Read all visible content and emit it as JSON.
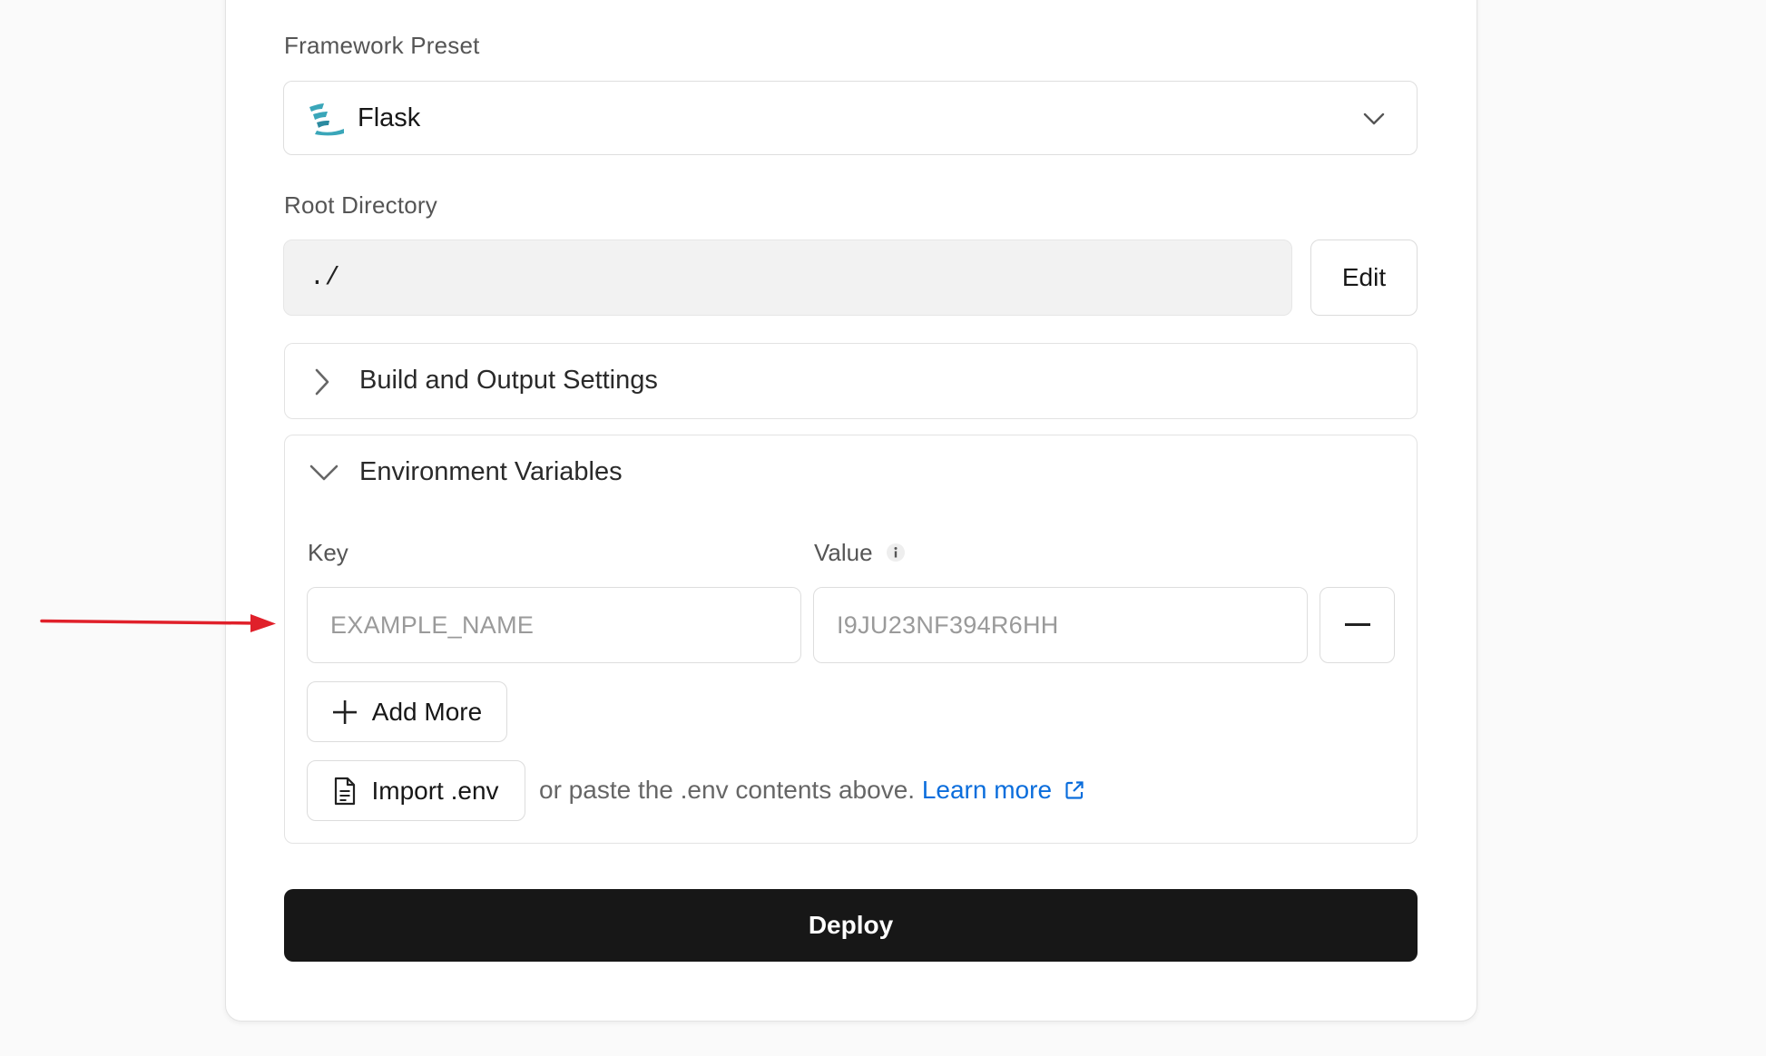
{
  "framework": {
    "label": "Framework Preset",
    "selected": "Flask",
    "icon": "flask-logo-icon"
  },
  "root_directory": {
    "label": "Root Directory",
    "value": "./",
    "edit_label": "Edit"
  },
  "build_section": {
    "title": "Build and Output Settings",
    "expanded": false
  },
  "env_section": {
    "title": "Environment Variables",
    "expanded": true,
    "key_label": "Key",
    "value_label": "Value",
    "key_placeholder": "EXAMPLE_NAME",
    "value_placeholder": "I9JU23NF394R6HH",
    "add_more_label": "Add More",
    "import_label": "Import .env",
    "hint_text": "or paste the .env contents above.",
    "learn_more_label": "Learn more"
  },
  "deploy_label": "Deploy",
  "colors": {
    "accent_link": "#0a6ddc",
    "deploy_bg": "#171717",
    "annotation_arrow": "#e0202a",
    "flask_logo": "#3aa6b9"
  }
}
